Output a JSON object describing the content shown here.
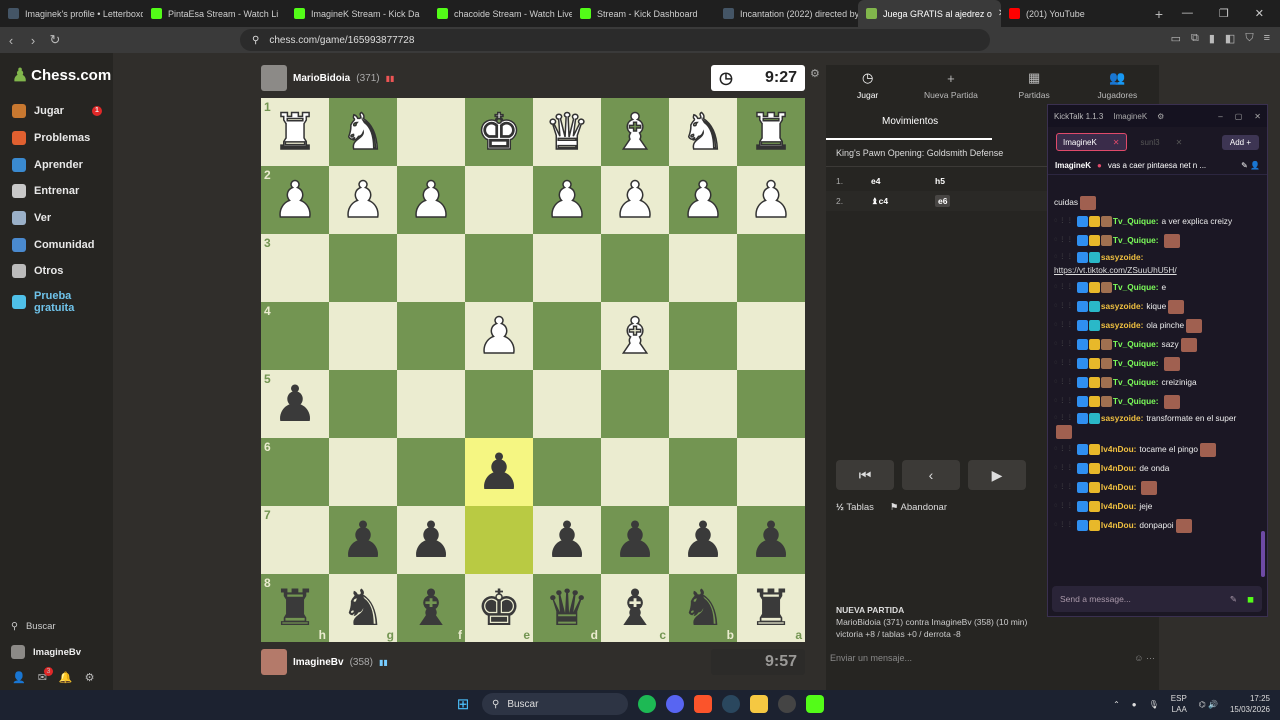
{
  "browser": {
    "tabs": [
      {
        "title": "Imaginek's profile • Letterboxd",
        "color": "#445566"
      },
      {
        "title": "PintaEsa Stream - Watch Li",
        "color": "#53fc18"
      },
      {
        "title": "ImagineK Stream - Kick Da",
        "color": "#53fc18"
      },
      {
        "title": "chacoide Stream - Watch Live",
        "color": "#53fc18"
      },
      {
        "title": "Stream - Kick Dashboard",
        "color": "#53fc18"
      },
      {
        "title": "Incantation (2022) directed by",
        "color": "#445566"
      },
      {
        "title": "Juega GRATIS al ajedrez o",
        "color": "#81b64c"
      },
      {
        "title": "(201) YouTube",
        "color": "#ff0000"
      }
    ],
    "url": "chess.com/game/165993877728"
  },
  "sidebar": {
    "logo": "Chess.com",
    "items": [
      {
        "label": "Jugar",
        "color": "#c87830",
        "badge": "1"
      },
      {
        "label": "Problemas",
        "color": "#e06030",
        "badge": ""
      },
      {
        "label": "Aprender",
        "color": "#3a8ad0",
        "badge": ""
      },
      {
        "label": "Entrenar",
        "color": "#c8c8c8",
        "badge": ""
      },
      {
        "label": "Ver",
        "color": "#9ab0c8",
        "badge": ""
      },
      {
        "label": "Comunidad",
        "color": "#4a8acf",
        "badge": ""
      },
      {
        "label": "Otros",
        "color": "#bbbbbb",
        "badge": ""
      },
      {
        "label": "Prueba gratuita",
        "color": "#4fc0e8",
        "badge": ""
      }
    ],
    "search_label": "Buscar",
    "username": "ImagineBv",
    "mail_badge": "3"
  },
  "players": {
    "top": {
      "name": "MarioBidoia",
      "rating": "(371)",
      "clock": "9:27"
    },
    "bottom": {
      "name": "ImagineBv",
      "rating": "(358)",
      "clock": "9:57"
    }
  },
  "board": {
    "rows": [
      [
        "wr",
        "wn",
        "",
        "wk",
        "wq",
        "wb",
        "wn",
        "wr"
      ],
      [
        "wp",
        "wp",
        "wp",
        "",
        "wp",
        "wp",
        "wp",
        "wp"
      ],
      [
        "",
        "",
        "",
        "",
        "",
        "",
        "",
        ""
      ],
      [
        "",
        "",
        "",
        "wp",
        "",
        "wb",
        "",
        ""
      ],
      [
        "bp",
        "",
        "",
        "",
        "",
        "",
        "",
        ""
      ],
      [
        "",
        "",
        "",
        "bp",
        "",
        "",
        "",
        ""
      ],
      [
        "",
        "bp",
        "bp",
        "",
        "bp",
        "bp",
        "bp",
        "bp"
      ],
      [
        "br",
        "bn",
        "bb",
        "bk",
        "bq",
        "bb",
        "bn",
        "br"
      ]
    ],
    "ranks": [
      "1",
      "2",
      "3",
      "4",
      "5",
      "6",
      "7",
      "8"
    ],
    "files": [
      "h",
      "g",
      "f",
      "e",
      "d",
      "c",
      "b",
      "a"
    ],
    "highlight": [
      [
        5,
        3
      ],
      [
        6,
        3
      ]
    ]
  },
  "panel": {
    "tabs": [
      {
        "label": "Jugar",
        "icon": "◷"
      },
      {
        "label": "Nueva Partida",
        "icon": "+"
      },
      {
        "label": "Partidas",
        "icon": "▦"
      },
      {
        "label": "Jugadores",
        "icon": "👥"
      }
    ],
    "moves_tab": "Movimientos",
    "opening": "King's Pawn Opening: Goldsmith Defense",
    "moves": [
      {
        "n": "1.",
        "w": "e4",
        "b": "h5"
      },
      {
        "n": "2.",
        "w": "♝c4",
        "b": "e6"
      }
    ],
    "draw": "Tablas",
    "resign": "Abandonar",
    "new_game": {
      "title": "NUEVA PARTIDA",
      "line1": "MarioBidoia (371) contra ImagineBv (358) (10 min)",
      "line2": "victoria +8 / tablas +0 / derrota -8"
    },
    "message_placeholder": "Enviar un mensaje..."
  },
  "kick": {
    "title": "KickTalk 1.1.3",
    "user": "ImagineK",
    "chips": [
      "ImagineK",
      "sunl3"
    ],
    "add": "Add",
    "stream_line": "vas a caer pintaesa net n ...",
    "messages": [
      {
        "user": "",
        "color": "#ffffff",
        "text": "cuidas",
        "badges": 0,
        "emote": true
      },
      {
        "user": "Tv_Quique:",
        "color": "#7cfc5a",
        "text": "a ver explica creizy",
        "badges": 3,
        "emote": false
      },
      {
        "user": "Tv_Quique:",
        "color": "#7cfc5a",
        "text": "",
        "badges": 3,
        "emote": true
      },
      {
        "user": "sasyzoide:",
        "color": "#f0c040",
        "text": "https://vt.tiktok.com/ZSuuUhU5H/",
        "badges": 1,
        "emote": false
      },
      {
        "user": "Tv_Quique:",
        "color": "#7cfc5a",
        "text": "e",
        "badges": 3,
        "emote": false
      },
      {
        "user": "sasyzoide:",
        "color": "#f0c040",
        "text": "kique",
        "badges": 1,
        "emote": true
      },
      {
        "user": "sasyzoide:",
        "color": "#f0c040",
        "text": "ola pinche",
        "badges": 1,
        "emote": true
      },
      {
        "user": "Tv_Quique:",
        "color": "#7cfc5a",
        "text": "sazy",
        "badges": 3,
        "emote": true
      },
      {
        "user": "Tv_Quique:",
        "color": "#7cfc5a",
        "text": "",
        "badges": 3,
        "emote": true
      },
      {
        "user": "Tv_Quique:",
        "color": "#7cfc5a",
        "text": "creiziniga",
        "badges": 3,
        "emote": false
      },
      {
        "user": "Tv_Quique:",
        "color": "#7cfc5a",
        "text": "",
        "badges": 3,
        "emote": true
      },
      {
        "user": "sasyzoide:",
        "color": "#f0c040",
        "text": "transformate en el super",
        "badges": 1,
        "emote": true
      },
      {
        "user": "Iv4nDou:",
        "color": "#f0c040",
        "text": "tocame el pingo",
        "badges": 1,
        "emote": true
      },
      {
        "user": "Iv4nDou:",
        "color": "#f0c040",
        "text": "de onda",
        "badges": 1,
        "emote": false
      },
      {
        "user": "Iv4nDou:",
        "color": "#f0c040",
        "text": "",
        "badges": 1,
        "emote": true
      },
      {
        "user": "Iv4nDou:",
        "color": "#f0c040",
        "text": "jeje",
        "badges": 1,
        "emote": false
      },
      {
        "user": "Iv4nDou:",
        "color": "#f0c040",
        "text": "donpapoi",
        "badges": 1,
        "emote": true
      }
    ],
    "input_placeholder": "Send a message..."
  },
  "taskbar": {
    "search": "Buscar",
    "lang1": "ESP",
    "lang2": "LAA",
    "time": "17:25",
    "date": "15/03/2026"
  }
}
